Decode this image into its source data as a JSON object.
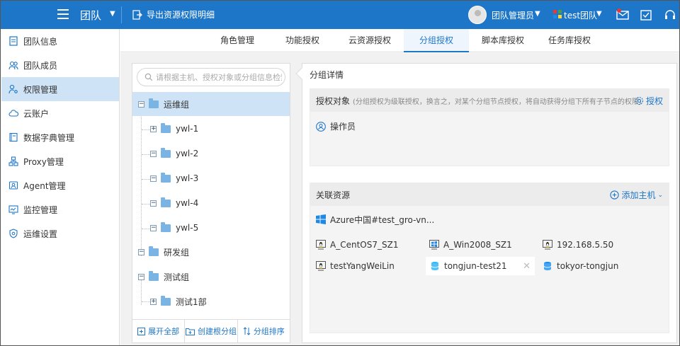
{
  "topbar": {
    "team_title": "团队",
    "export_label": "导出资源权限明细",
    "user_name": "团队管理员",
    "team_name": "test团队"
  },
  "sidebar": {
    "items": [
      {
        "label": "团队信息",
        "icon": "doc-icon"
      },
      {
        "label": "团队成员",
        "icon": "users-icon"
      },
      {
        "label": "权限管理",
        "icon": "user-key-icon",
        "active": true
      },
      {
        "label": "云账户",
        "icon": "cloud-icon"
      },
      {
        "label": "数据字典管理",
        "icon": "book-icon"
      },
      {
        "label": "Proxy管理",
        "icon": "network-icon"
      },
      {
        "label": "Agent管理",
        "icon": "agent-icon"
      },
      {
        "label": "监控管理",
        "icon": "monitor-icon"
      },
      {
        "label": "运维设置",
        "icon": "shield-gear-icon"
      }
    ]
  },
  "tabs": [
    {
      "label": "角色管理"
    },
    {
      "label": "功能授权"
    },
    {
      "label": "云资源授权"
    },
    {
      "label": "分组授权",
      "active": true
    },
    {
      "label": "脚本库授权"
    },
    {
      "label": "任务库授权"
    }
  ],
  "tree": {
    "search_placeholder": "请根据主机、授权对象或分组信息检索",
    "nodes": [
      {
        "label": "运维组",
        "toggle": "−",
        "active": true
      },
      {
        "label": "ywl-1",
        "toggle": "+"
      },
      {
        "label": "ywl-2",
        "toggle": "−"
      },
      {
        "label": "ywl-3",
        "toggle": "−"
      },
      {
        "label": "ywl-4",
        "toggle": "−"
      },
      {
        "label": "ywl-5",
        "toggle": "−"
      },
      {
        "label": "研发组",
        "toggle": "−"
      },
      {
        "label": "测试组",
        "toggle": "−"
      },
      {
        "label": "测试1部",
        "toggle": "+"
      }
    ],
    "footer": {
      "expand_all": "展开全部",
      "create_root": "创建根分组",
      "sort": "分组排序"
    }
  },
  "detail": {
    "title": "分组详情",
    "auth": {
      "heading": "授权对象",
      "note": "(分组授权为级联授权，换言之，对某个分组节点授权，将自动获得分组下所有子节点的权限)",
      "action": "授权",
      "role": "操作员"
    },
    "resources": {
      "heading": "关联资源",
      "action": "添加主机",
      "cloud": "Azure中国#test_gro-vn...",
      "hosts": [
        {
          "label": "A_CentOS7_SZ1",
          "icon": "linux-icon"
        },
        {
          "label": "A_Win2008_SZ1",
          "icon": "windows-icon"
        },
        {
          "label": "192.168.5.50",
          "icon": "linux-icon"
        },
        {
          "label": "testYangWeiLin",
          "icon": "linux-icon"
        },
        {
          "label": "tongjun-test21",
          "icon": "database-icon",
          "hover": true
        },
        {
          "label": "tokyor-tongjun",
          "icon": "database-icon"
        }
      ]
    }
  },
  "colors": {
    "brand": "#1e76c9",
    "active_bg": "#cfe3f6",
    "panel_bg": "#f1f1f1"
  }
}
